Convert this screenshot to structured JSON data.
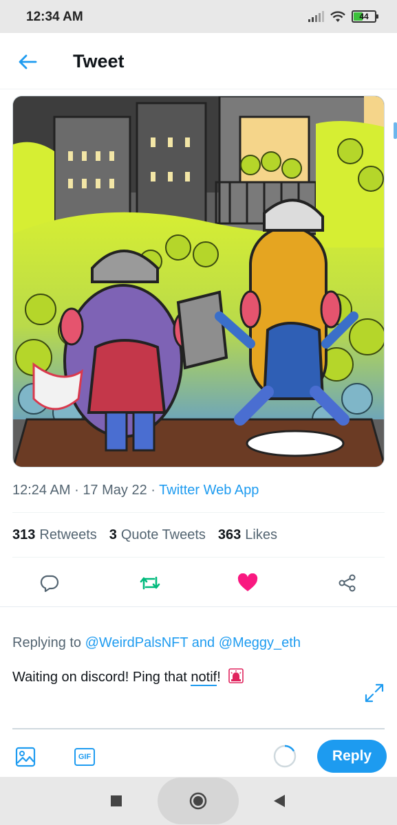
{
  "status_bar": {
    "time": "12:34 AM",
    "battery": "44",
    "icons": [
      "signal-icon",
      "wifi-icon",
      "battery-icon"
    ]
  },
  "header": {
    "back_icon": "arrow-left-icon",
    "title": "Tweet"
  },
  "tweet": {
    "image_icon": "cartoon-illustration-image",
    "time": "12:24 AM",
    "separator": "·",
    "date": "17 May 22",
    "source": "Twitter Web App",
    "stats": {
      "retweets_count": "313",
      "retweets_label": "Retweets",
      "quotes_count": "3",
      "quotes_label": "Quote Tweets",
      "likes_count": "363",
      "likes_label": "Likes"
    },
    "actions": [
      "reply-icon",
      "retweet-icon",
      "like-icon",
      "share-icon"
    ]
  },
  "reply": {
    "replying_prefix": "Replying to",
    "handle_1": "@WeirdPalsNFT",
    "and_word": "and",
    "handle_2": "@Meggy_eth",
    "text_before": "Waiting on discord! Ping that ",
    "text_underlined": "notif",
    "text_after": "!",
    "button_label": "Reply",
    "gif_label": "GIF"
  },
  "colors": {
    "accent": "#1d9bf0",
    "retweet": "#00ba7c",
    "like": "#f91880",
    "secondary_text": "#536471"
  }
}
